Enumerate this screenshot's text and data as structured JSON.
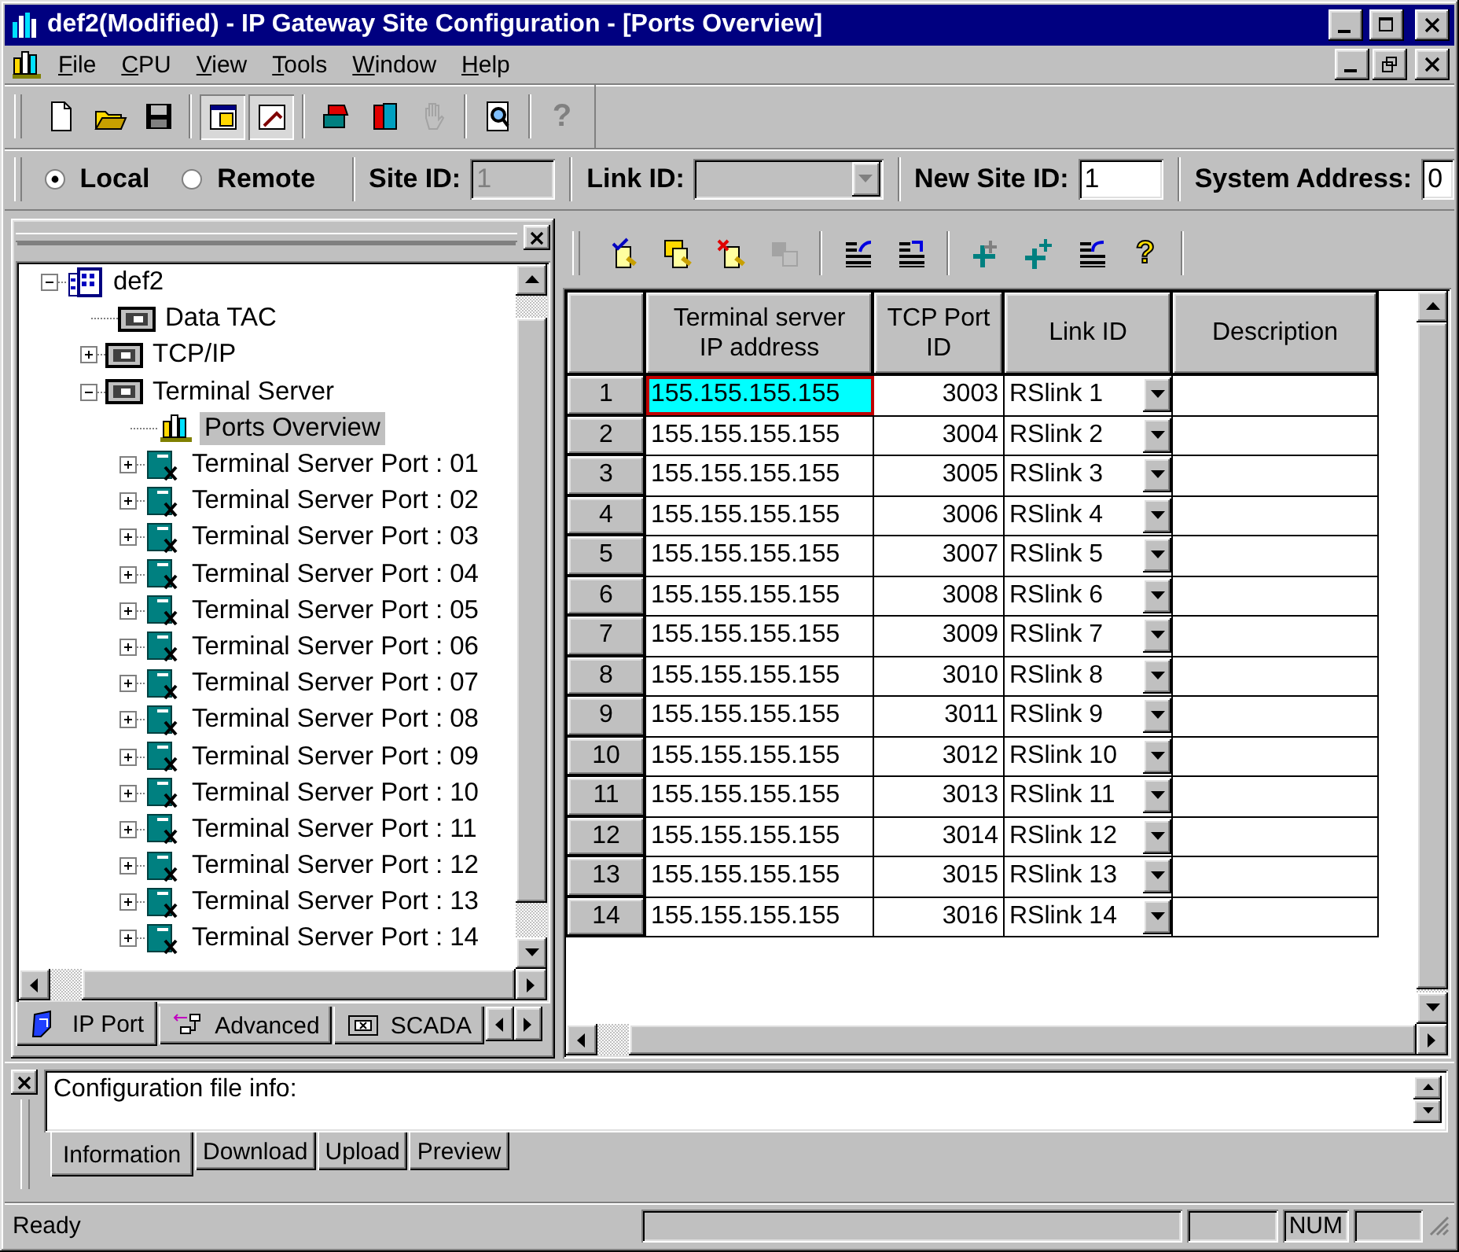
{
  "window": {
    "title": "def2(Modified) - IP Gateway Site Configuration - [Ports Overview]"
  },
  "menu": [
    "File",
    "CPU",
    "View",
    "Tools",
    "Window",
    "Help"
  ],
  "main_toolbar": [
    [
      {
        "kind": "new",
        "pressed": false,
        "disabled": false
      },
      {
        "kind": "open",
        "pressed": false,
        "disabled": false
      },
      {
        "kind": "save",
        "pressed": false,
        "disabled": false
      }
    ],
    [
      {
        "kind": "tree-view",
        "pressed": true,
        "disabled": false
      },
      {
        "kind": "output-view",
        "pressed": true,
        "disabled": false
      }
    ],
    [
      {
        "kind": "connect",
        "pressed": false,
        "disabled": false
      },
      {
        "kind": "transfer",
        "pressed": false,
        "disabled": false
      },
      {
        "kind": "hand",
        "pressed": false,
        "disabled": true
      }
    ],
    [
      {
        "kind": "preview",
        "pressed": false,
        "disabled": false
      }
    ],
    [
      {
        "kind": "help",
        "glyph": "?",
        "pressed": false,
        "disabled": true
      }
    ]
  ],
  "site_bar": {
    "modes": [
      {
        "label": "Local",
        "selected": true
      },
      {
        "label": "Remote",
        "selected": false
      }
    ],
    "site_id": {
      "label": "Site ID:",
      "value": "1",
      "disabled": true
    },
    "link_id": {
      "label": "Link ID:",
      "disabled": true
    },
    "new_site_id": {
      "label": "New Site ID:",
      "value": "1"
    },
    "system_address": {
      "label": "System Address:",
      "value": "0"
    }
  },
  "tree": {
    "items": [
      {
        "label": "def2",
        "kind": "site",
        "expanded": true,
        "selected": false,
        "children": [
          {
            "label": "Data TAC",
            "kind": "module",
            "selected": false
          },
          {
            "label": "TCP/IP",
            "kind": "module",
            "expanded": false,
            "selected": false
          },
          {
            "label": "Terminal Server",
            "kind": "module",
            "expanded": true,
            "selected": false,
            "children": [
              {
                "label": "Ports Overview",
                "kind": "chart",
                "selected": true
              },
              {
                "label": "Terminal Server Port : 01",
                "kind": "port",
                "expanded": false,
                "selected": false
              },
              {
                "label": "Terminal Server Port : 02",
                "kind": "port",
                "expanded": false,
                "selected": false
              },
              {
                "label": "Terminal Server Port : 03",
                "kind": "port",
                "expanded": false,
                "selected": false
              },
              {
                "label": "Terminal Server Port : 04",
                "kind": "port",
                "expanded": false,
                "selected": false
              },
              {
                "label": "Terminal Server Port : 05",
                "kind": "port",
                "expanded": false,
                "selected": false
              },
              {
                "label": "Terminal Server Port : 06",
                "kind": "port",
                "expanded": false,
                "selected": false
              },
              {
                "label": "Terminal Server Port : 07",
                "kind": "port",
                "expanded": false,
                "selected": false
              },
              {
                "label": "Terminal Server Port : 08",
                "kind": "port",
                "expanded": false,
                "selected": false
              },
              {
                "label": "Terminal Server Port : 09",
                "kind": "port",
                "expanded": false,
                "selected": false
              },
              {
                "label": "Terminal Server Port : 10",
                "kind": "port",
                "expanded": false,
                "selected": false
              },
              {
                "label": "Terminal Server Port : 11",
                "kind": "port",
                "expanded": false,
                "selected": false
              },
              {
                "label": "Terminal Server Port : 12",
                "kind": "port",
                "expanded": false,
                "selected": false
              },
              {
                "label": "Terminal Server Port : 13",
                "kind": "port",
                "expanded": false,
                "selected": false
              },
              {
                "label": "Terminal Server Port : 14",
                "kind": "port",
                "expanded": false,
                "selected": false
              }
            ]
          }
        ]
      }
    ]
  },
  "tree_tabs": [
    {
      "label": "IP Port",
      "kind": "ip",
      "selected": true
    },
    {
      "label": "Advanced",
      "kind": "advanced",
      "selected": false
    },
    {
      "label": "SCADA",
      "kind": "scada",
      "selected": false
    }
  ],
  "grid_toolbar": [
    [
      {
        "kind": "doc-check",
        "disabled": false
      },
      {
        "kind": "doc-save",
        "disabled": false
      },
      {
        "kind": "doc-delete",
        "disabled": false
      },
      {
        "kind": "copy",
        "disabled": true
      }
    ],
    [
      {
        "kind": "import-rows",
        "disabled": false
      },
      {
        "kind": "swap-rows",
        "disabled": false
      }
    ],
    [
      {
        "kind": "add-column",
        "disabled": false
      },
      {
        "kind": "add-row",
        "disabled": false
      },
      {
        "kind": "export-rows",
        "disabled": false
      },
      {
        "kind": "help",
        "glyph": "?",
        "disabled": false
      }
    ]
  ],
  "grid": {
    "columns": [
      "Terminal server IP address",
      "TCP Port ID",
      "Link ID",
      "Description"
    ],
    "rows": [
      {
        "number": "1",
        "ip": "155.155.155.155",
        "port": "3003",
        "link": "RSlink 1",
        "selected": true
      },
      {
        "number": "2",
        "ip": "155.155.155.155",
        "port": "3004",
        "link": "RSlink 2",
        "selected": false
      },
      {
        "number": "3",
        "ip": "155.155.155.155",
        "port": "3005",
        "link": "RSlink 3",
        "selected": false
      },
      {
        "number": "4",
        "ip": "155.155.155.155",
        "port": "3006",
        "link": "RSlink 4",
        "selected": false
      },
      {
        "number": "5",
        "ip": "155.155.155.155",
        "port": "3007",
        "link": "RSlink 5",
        "selected": false
      },
      {
        "number": "6",
        "ip": "155.155.155.155",
        "port": "3008",
        "link": "RSlink 6",
        "selected": false
      },
      {
        "number": "7",
        "ip": "155.155.155.155",
        "port": "3009",
        "link": "RSlink 7",
        "selected": false
      },
      {
        "number": "8",
        "ip": "155.155.155.155",
        "port": "3010",
        "link": "RSlink 8",
        "selected": false
      },
      {
        "number": "9",
        "ip": "155.155.155.155",
        "port": "3011",
        "link": "RSlink 9",
        "selected": false
      },
      {
        "number": "10",
        "ip": "155.155.155.155",
        "port": "3012",
        "link": "RSlink 10",
        "selected": false
      },
      {
        "number": "11",
        "ip": "155.155.155.155",
        "port": "3013",
        "link": "RSlink 11",
        "selected": false
      },
      {
        "number": "12",
        "ip": "155.155.155.155",
        "port": "3014",
        "link": "RSlink 12",
        "selected": false
      },
      {
        "number": "13",
        "ip": "155.155.155.155",
        "port": "3015",
        "link": "RSlink 13",
        "selected": false
      },
      {
        "number": "14",
        "ip": "155.155.155.155",
        "port": "3016",
        "link": "RSlink 14",
        "selected": false
      }
    ]
  },
  "info_panel": {
    "text": "Configuration file info:",
    "tabs": [
      {
        "label": "Information",
        "selected": true
      },
      {
        "label": "Download",
        "selected": false
      },
      {
        "label": "Upload",
        "selected": false
      },
      {
        "label": "Preview",
        "selected": false
      }
    ]
  },
  "status_bar": {
    "message": "Ready",
    "num_lock": "NUM"
  }
}
